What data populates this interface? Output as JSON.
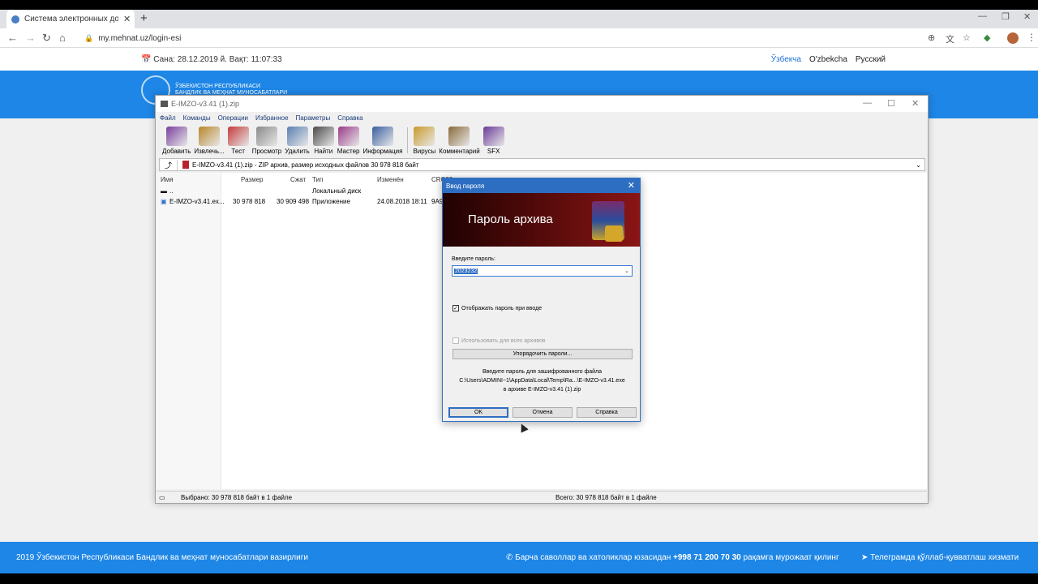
{
  "browser": {
    "tab_title": "Система электронных договоро",
    "tab_close": "✕",
    "new_tab": "+",
    "url": "my.mehnat.uz/login-esi"
  },
  "page": {
    "date_info": "📅 Сана: 28.12.2019 й.  Вақт: 11:07:33",
    "languages": [
      "Ўзбекча",
      "O'zbekcha",
      "Русский"
    ],
    "org_name_line1": "ЎЗБЕКИСТОН РЕСПУБЛИКАСИ",
    "org_name_line2": "БАНДЛИК ВА МЕҲНАТ МУНОСАБАТЛАРИ",
    "footer_left": "2019 Ўзбекистон Республикаси Бандлик ва меҳнат муносабатлари вазирлиги",
    "footer_mid_pre": "Барча саволлар ва хатоликлар юзасидан ",
    "footer_phone": "+998 71 200 70 30",
    "footer_mid_post": " рақамга мурожаат қилинг",
    "footer_right": "Телеграмда қўллаб-қувватлаш хизмати"
  },
  "winrar": {
    "title": "E-IMZO-v3.41 (1).zip",
    "menu": [
      "Файл",
      "Команды",
      "Операции",
      "Избранное",
      "Параметры",
      "Справка"
    ],
    "toolbar": [
      {
        "label": "Добавить",
        "color": "#7a3f9d"
      },
      {
        "label": "Извлечь...",
        "color": "#b8862a"
      },
      {
        "label": "Тест",
        "color": "#c43a3a"
      },
      {
        "label": "Просмотр",
        "color": "#8a8a8a"
      },
      {
        "label": "Удалить",
        "color": "#5a7fb0"
      },
      {
        "label": "Найти",
        "color": "#4a4a4a"
      },
      {
        "label": "Мастер",
        "color": "#9b3a8a"
      },
      {
        "label": "Информация",
        "color": "#3a5fa0"
      }
    ],
    "toolbar2": [
      {
        "label": "Вирусы",
        "color": "#c89a2a"
      },
      {
        "label": "Комментарий",
        "color": "#8a6a3a"
      },
      {
        "label": "SFX",
        "color": "#6a3a9a"
      }
    ],
    "path": "E-IMZO-v3.41 (1).zip - ZIP архив, размер исходных файлов 30 978 818 байт",
    "columns": {
      "name": "Имя",
      "size": "Размер",
      "packed": "Сжат",
      "type": "Тип",
      "modified": "Изменён",
      "crc": "CRC32"
    },
    "rows": [
      {
        "name": "..",
        "size": "",
        "packed": "",
        "type": "Локальный диск",
        "modified": "",
        "crc": ""
      },
      {
        "name": "E-IMZO-v3.41.ex...",
        "size": "30 978 818",
        "packed": "30 909 498",
        "type": "Приложение",
        "modified": "24.08.2018 18:11",
        "crc": "9A9"
      }
    ],
    "status_left": "Выбрано: 30 978 818 байт в 1 файле",
    "status_right": "Всего: 30 978 818 байт в 1 файле"
  },
  "dialog": {
    "title": "Ввод пароля",
    "banner": "Пароль архива",
    "prompt": "Введите пароль:",
    "password": "2023232",
    "show_password": "Отображать пароль при вводе",
    "use_all": "Использовать для всех архивов",
    "organize": "Упорядочить пароли...",
    "info_line1": "Введите пароль для зашифрованного файла",
    "info_line2": "C:\\Users\\ADMINI~1\\AppData\\Local\\Temp\\Ra...\\E-IMZO-v3.41.exe",
    "info_line3": "в архиве E-IMZO-v3.41 (1).zip",
    "ok": "OK",
    "cancel": "Отмена",
    "help": "Справка"
  }
}
